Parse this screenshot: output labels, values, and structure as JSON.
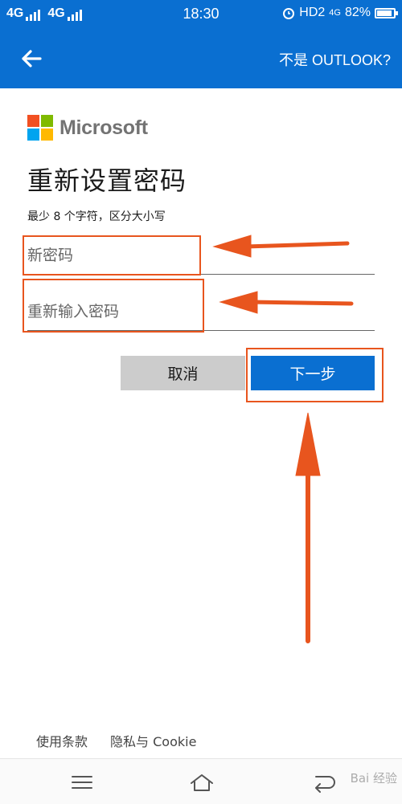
{
  "status_bar": {
    "left_networks": [
      "4G",
      "4G"
    ],
    "time": "18:30",
    "hd": "HD2",
    "net_type": "4G",
    "battery_label": "82%",
    "battery_level": 0.82
  },
  "app_bar": {
    "back_icon": "arrow-left-icon",
    "not_outlook": "不是 OUTLOOK?"
  },
  "brand": {
    "name": "Microsoft"
  },
  "form": {
    "title": "重新设置密码",
    "hint": "最少 8 个字符，区分大小写",
    "new_password_placeholder": "新密码",
    "confirm_password_placeholder": "重新输入密码",
    "cancel_label": "取消",
    "next_label": "下一步"
  },
  "footer": {
    "terms": "使用条款",
    "privacy": "隐私与 Cookie"
  },
  "nav_bar": {
    "icons": [
      "menu-icon",
      "home-icon",
      "back-icon"
    ]
  },
  "watermark": "Bai 经验",
  "colors": {
    "primary": "#0a6fd1",
    "annotation": "#e8551e",
    "cancel_bg": "#cccccc"
  }
}
